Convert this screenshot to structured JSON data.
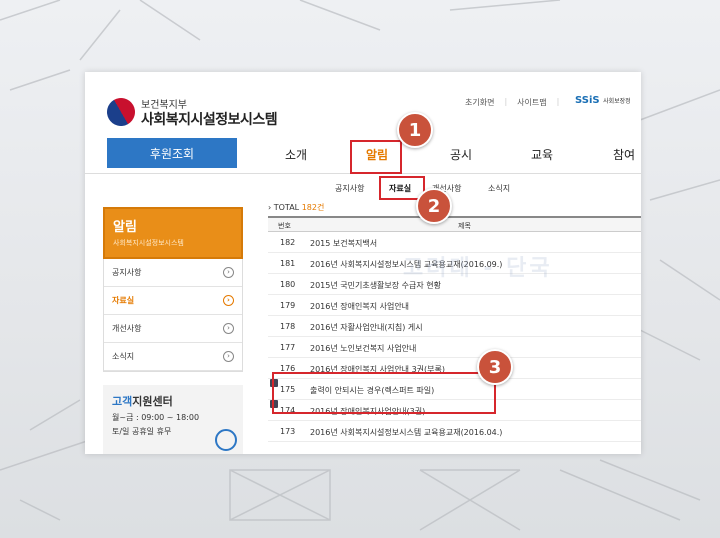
{
  "header": {
    "org_small": "보건복지부",
    "org_name": "사회복지시설정보시스템",
    "links": [
      "초기화면",
      "사이트맵"
    ],
    "ssis_logo": "SSiS",
    "ssis_text": "사회보장정"
  },
  "gnb": {
    "sponsor_label": "후원조회",
    "items": [
      "소개",
      "알림",
      "공시",
      "교육",
      "참여"
    ],
    "active": "알림"
  },
  "subnav": {
    "items": [
      "공지사항",
      "자료실",
      "개선사항",
      "소식지"
    ],
    "active": "자료실"
  },
  "lnb": {
    "title": "알림",
    "subtitle": "사회복지시설정보시스템",
    "items": [
      "공지사항",
      "자료실",
      "개선사항",
      "소식지"
    ],
    "active": "자료실"
  },
  "customer_center": {
    "title_highlight": "고객",
    "title_rest": "지원센터",
    "hours": "월~금 : 09:00 ~ 18:00",
    "closed": "토/일 공휴일 휴무"
  },
  "board": {
    "total_label": "TOTAL",
    "total_count": "182건",
    "columns": [
      "번호",
      "제목"
    ],
    "rows": [
      {
        "num": "182",
        "title": "2015 보건복지백서"
      },
      {
        "num": "181",
        "title": "2016년 사회복지시설정보시스템 교육용교재(2016.09.)"
      },
      {
        "num": "180",
        "title": "2015년 국민기초생활보장 수급자 현황"
      },
      {
        "num": "179",
        "title": "2016년 장애인복지 사업안내"
      },
      {
        "num": "178",
        "title": "2016년 자활사업안내(지침) 게시"
      },
      {
        "num": "177",
        "title": "2016년 노인보건복지 사업안내"
      },
      {
        "num": "176",
        "title": "2016년 장애인복지 사업안내 3권(부록)"
      },
      {
        "num": "175",
        "title": "출력이 안되시는 경우(렉스퍼트 파일)"
      },
      {
        "num": "174",
        "title": "2016년 장애인복지사업안내(3권)"
      },
      {
        "num": "173",
        "title": "2016년 사회복지시설정보시스템 교육용교재(2016.04.)"
      }
    ]
  },
  "watermark": "고려대 - 단국",
  "steps": [
    "1",
    "2",
    "3"
  ],
  "colors": {
    "accent": "#e98e18",
    "primary": "#2d77c5",
    "highlight": "#d6262c",
    "badge": "#c9523b"
  }
}
